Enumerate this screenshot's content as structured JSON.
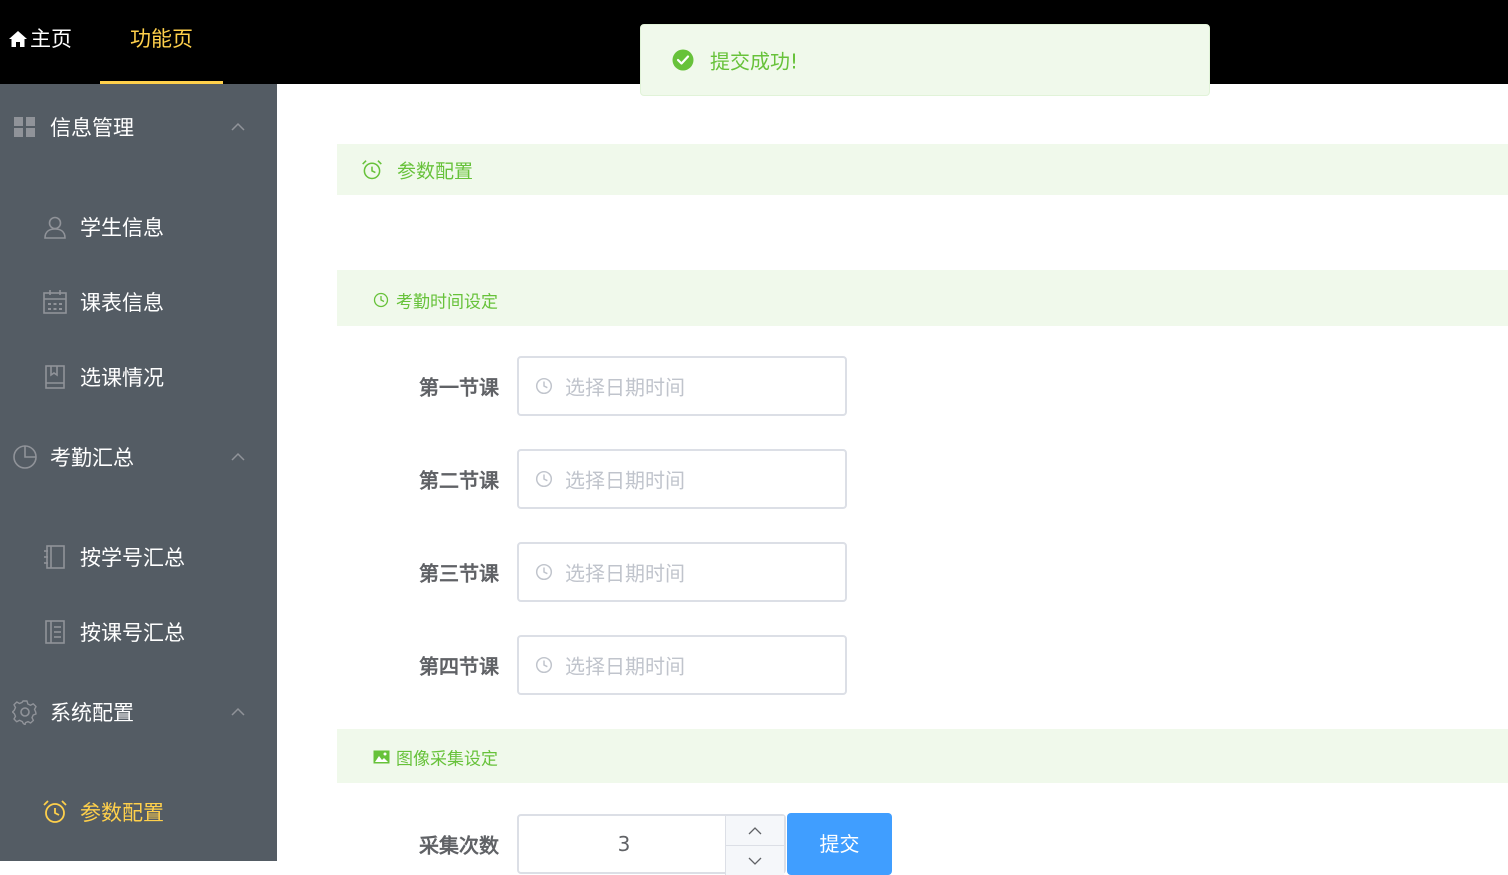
{
  "topnav": {
    "home_label": "主页",
    "function_label": "功能页"
  },
  "sidebar": {
    "groups": [
      {
        "label": "信息管理",
        "icon": "grid-icon",
        "items": [
          {
            "label": "学生信息",
            "icon": "user-icon"
          },
          {
            "label": "课表信息",
            "icon": "calendar-icon"
          },
          {
            "label": "选课情况",
            "icon": "notebook-icon"
          }
        ]
      },
      {
        "label": "考勤汇总",
        "icon": "pie-chart-icon",
        "items": [
          {
            "label": "按学号汇总",
            "icon": "notebook-icon"
          },
          {
            "label": "按课号汇总",
            "icon": "tickets-icon"
          }
        ]
      },
      {
        "label": "系统配置",
        "icon": "gear-icon",
        "items": [
          {
            "label": "参数配置",
            "icon": "alarm-clock-icon",
            "active": true
          }
        ]
      }
    ]
  },
  "main": {
    "page_header": "参数配置",
    "attendance_section": {
      "title": "考勤时间设定",
      "rows": [
        {
          "label": "第一节课",
          "placeholder": "选择日期时间"
        },
        {
          "label": "第二节课",
          "placeholder": "选择日期时间"
        },
        {
          "label": "第三节课",
          "placeholder": "选择日期时间"
        },
        {
          "label": "第四节课",
          "placeholder": "选择日期时间"
        }
      ]
    },
    "image_section": {
      "title": "图像采集设定",
      "capture_label": "采集次数",
      "capture_value": "3",
      "submit_label": "提交"
    }
  },
  "toast": {
    "message": "提交成功!"
  },
  "colors": {
    "topbar": "#000000",
    "sidebar": "#545c64",
    "active": "#ffd04b",
    "success": "#67c23a",
    "success_bg": "#f0f9eb",
    "primary": "#409eff"
  }
}
